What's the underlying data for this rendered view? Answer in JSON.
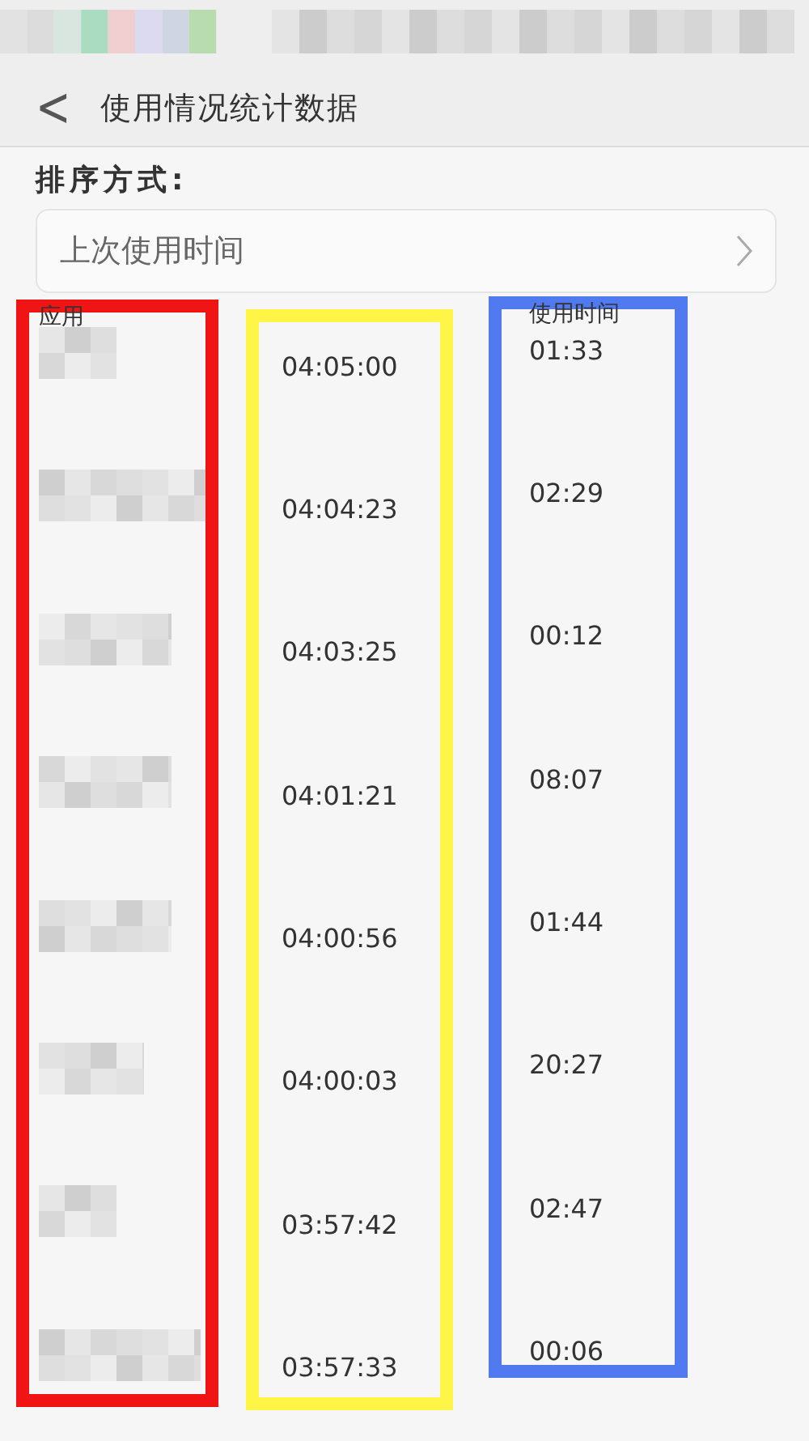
{
  "header": {
    "back": "<",
    "title": "使用情况统计数据"
  },
  "sort": {
    "label": "排序方式:",
    "value": "上次使用时间"
  },
  "columns": [
    {
      "kind": "app",
      "header": "应用",
      "color": "#f01414"
    },
    {
      "kind": "last_used",
      "color": "#fff546"
    },
    {
      "kind": "usage",
      "header": "使用时间",
      "color": "#5179f0"
    }
  ],
  "rows": [
    {
      "last_used": "04:05:00",
      "usage": "01:33"
    },
    {
      "last_used": "04:04:23",
      "usage": "02:29"
    },
    {
      "last_used": "04:03:25",
      "usage": "00:12"
    },
    {
      "last_used": "04:01:21",
      "usage": "08:07"
    },
    {
      "last_used": "04:00:56",
      "usage": "01:44"
    },
    {
      "last_used": "04:00:03",
      "usage": "20:27"
    },
    {
      "last_used": "03:57:42",
      "usage": "02:47"
    },
    {
      "last_used": "03:57:33",
      "usage": "00:06"
    }
  ]
}
